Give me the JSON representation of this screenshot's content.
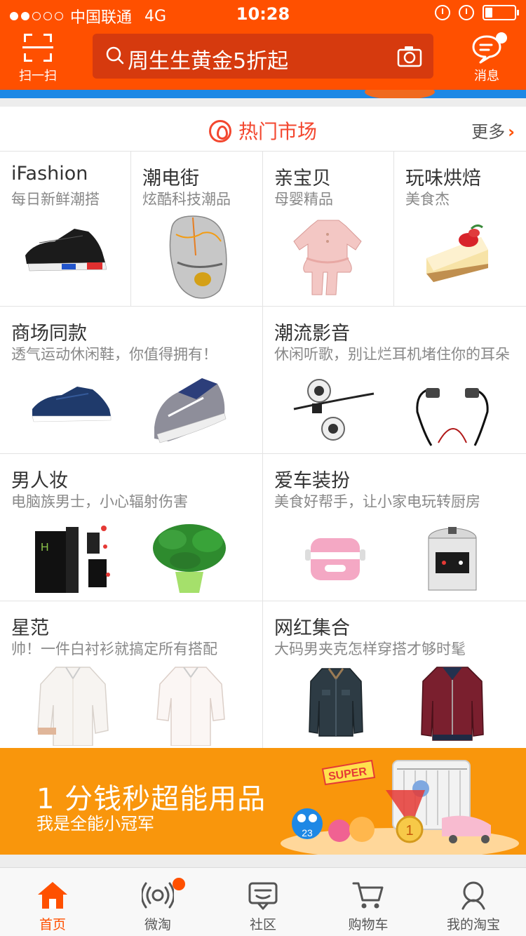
{
  "status_bar": {
    "carrier": "中国联通",
    "network": "4G",
    "time": "10:28"
  },
  "header": {
    "scan_label": "扫一扫",
    "search_text": "周生生黄金5折起",
    "message_label": "消息"
  },
  "market": {
    "title": "热门市场",
    "more_label": "更多",
    "top_cells": [
      {
        "title": "iFashion",
        "subtitle": "每日新鲜潮搭",
        "image": "sneaker"
      },
      {
        "title": "潮电街",
        "subtitle": "炫酷科技潮品",
        "image": "gaming-mouse"
      },
      {
        "title": "亲宝贝",
        "subtitle": "母婴精品",
        "image": "baby-dress"
      },
      {
        "title": "玩味烘焙",
        "subtitle": "美食杰",
        "image": "cake"
      }
    ],
    "rows": [
      [
        {
          "title": "商场同款",
          "subtitle": "透气运动休闲鞋，你值得拥有！",
          "images": [
            "blue-sneaker",
            "grey-sneaker"
          ]
        },
        {
          "title": "潮流影音",
          "subtitle": "休闲听歌，别让烂耳机堵住你的耳朵",
          "images": [
            "white-earphones",
            "black-earphones"
          ]
        }
      ],
      [
        {
          "title": "男人妆",
          "subtitle": "电脑族男士，小心辐射伤害",
          "images": [
            "mens-skincare",
            "potted-plant"
          ]
        },
        {
          "title": "爱车装扮",
          "subtitle": "美食好帮手，让小家电玩转厨房",
          "images": [
            "lunch-box",
            "pressure-cooker"
          ]
        }
      ],
      [
        {
          "title": "星范",
          "subtitle": "帅！一件白衬衫就搞定所有搭配",
          "images": [
            "white-shirt",
            "white-shirt-2"
          ]
        },
        {
          "title": "网红集合",
          "subtitle": "大码男夹克怎样穿搭才够时髦",
          "images": [
            "denim-jacket",
            "red-jacket"
          ]
        }
      ]
    ]
  },
  "promo": {
    "title": "1 分钱秒超能用品",
    "subtitle": "我是全能小冠军",
    "badge_text": "SUPER",
    "medal_text": "1",
    "mascot_number": "23"
  },
  "tabbar": {
    "tabs": [
      {
        "label": "首页",
        "icon": "home-icon",
        "active": true
      },
      {
        "label": "微淘",
        "icon": "broadcast-icon",
        "active": false
      },
      {
        "label": "社区",
        "icon": "chat-icon",
        "active": false
      },
      {
        "label": "购物车",
        "icon": "cart-icon",
        "active": false
      },
      {
        "label": "我的淘宝",
        "icon": "user-icon",
        "active": false
      }
    ]
  },
  "colors": {
    "brand": "#ff5000",
    "search_bg": "#d63a0e",
    "market_title": "#f3472f",
    "promo_bg": "#f9960c"
  }
}
